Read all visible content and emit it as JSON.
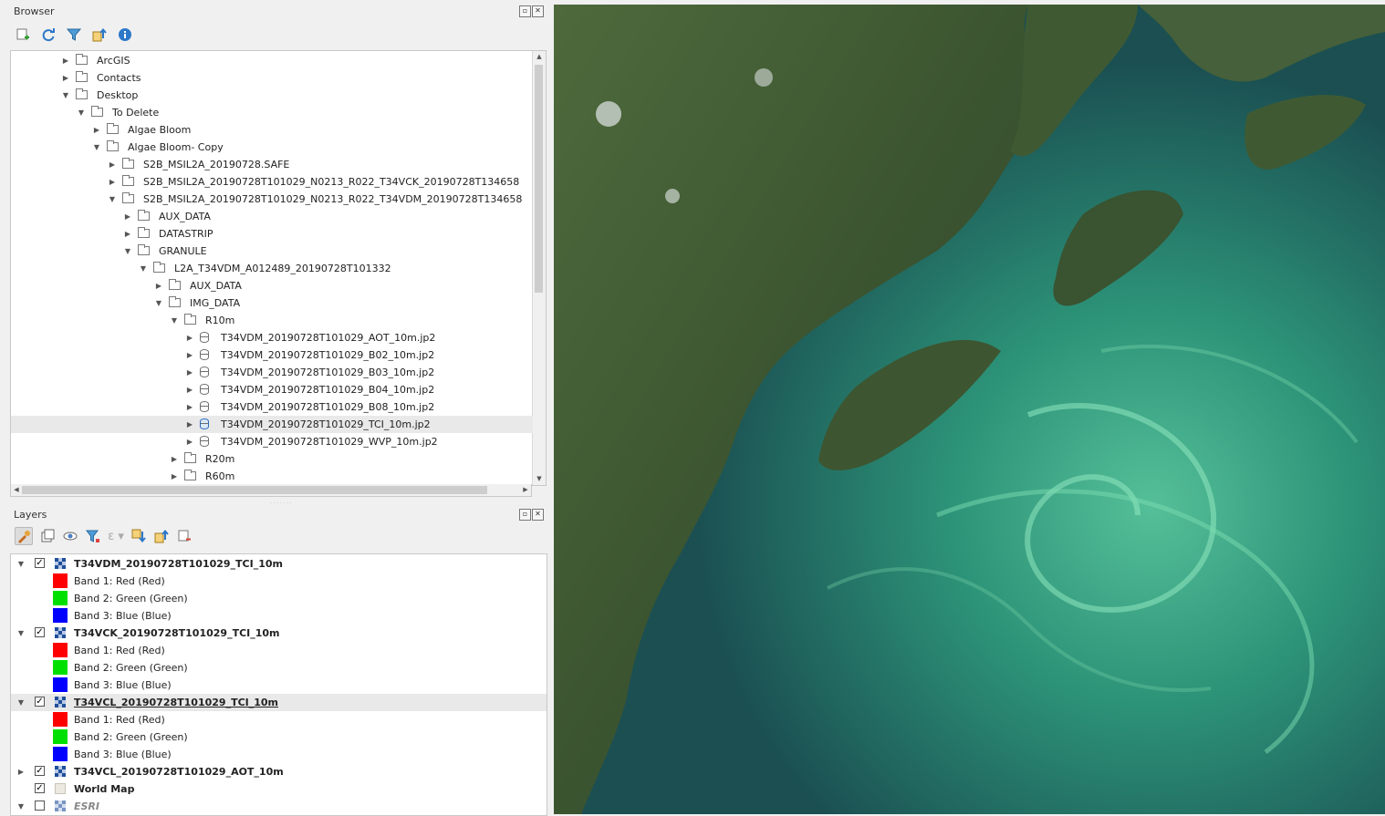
{
  "browser": {
    "title": "Browser",
    "toolbar": [
      "add-selected-icon",
      "refresh-icon",
      "filter-icon",
      "collapse-all-icon",
      "properties-icon"
    ],
    "tree": [
      {
        "indent": 0,
        "type": "folder",
        "arrow": "right",
        "label": "ArcGIS"
      },
      {
        "indent": 0,
        "type": "folder",
        "arrow": "right",
        "label": "Contacts"
      },
      {
        "indent": 0,
        "type": "folder",
        "arrow": "down",
        "label": "Desktop"
      },
      {
        "indent": 1,
        "type": "folder",
        "arrow": "down",
        "label": "To Delete"
      },
      {
        "indent": 2,
        "type": "folder",
        "arrow": "right",
        "label": "Algae Bloom"
      },
      {
        "indent": 2,
        "type": "folder",
        "arrow": "down",
        "label": "Algae Bloom- Copy"
      },
      {
        "indent": 3,
        "type": "folder",
        "arrow": "right",
        "label": "S2B_MSIL2A_20190728.SAFE"
      },
      {
        "indent": 3,
        "type": "folder",
        "arrow": "right",
        "label": "S2B_MSIL2A_20190728T101029_N0213_R022_T34VCK_20190728T134658"
      },
      {
        "indent": 3,
        "type": "folder",
        "arrow": "down",
        "label": "S2B_MSIL2A_20190728T101029_N0213_R022_T34VDM_20190728T134658"
      },
      {
        "indent": 4,
        "type": "folder",
        "arrow": "right",
        "label": "AUX_DATA"
      },
      {
        "indent": 4,
        "type": "folder",
        "arrow": "right",
        "label": "DATASTRIP"
      },
      {
        "indent": 4,
        "type": "folder",
        "arrow": "down",
        "label": "GRANULE"
      },
      {
        "indent": 5,
        "type": "folder",
        "arrow": "down",
        "label": "L2A_T34VDM_A012489_20190728T101332"
      },
      {
        "indent": 6,
        "type": "folder",
        "arrow": "right",
        "label": "AUX_DATA"
      },
      {
        "indent": 6,
        "type": "folder",
        "arrow": "down",
        "label": "IMG_DATA"
      },
      {
        "indent": 7,
        "type": "folder",
        "arrow": "down",
        "label": "R10m"
      },
      {
        "indent": 8,
        "type": "db",
        "arrow": "right",
        "label": "T34VDM_20190728T101029_AOT_10m.jp2"
      },
      {
        "indent": 8,
        "type": "db",
        "arrow": "right",
        "label": "T34VDM_20190728T101029_B02_10m.jp2"
      },
      {
        "indent": 8,
        "type": "db",
        "arrow": "right",
        "label": "T34VDM_20190728T101029_B03_10m.jp2"
      },
      {
        "indent": 8,
        "type": "db",
        "arrow": "right",
        "label": "T34VDM_20190728T101029_B04_10m.jp2"
      },
      {
        "indent": 8,
        "type": "db",
        "arrow": "right",
        "label": "T34VDM_20190728T101029_B08_10m.jp2"
      },
      {
        "indent": 8,
        "type": "db",
        "arrow": "right",
        "label": "T34VDM_20190728T101029_TCI_10m.jp2",
        "selected": true
      },
      {
        "indent": 8,
        "type": "db",
        "arrow": "right",
        "label": "T34VDM_20190728T101029_WVP_10m.jp2"
      },
      {
        "indent": 7,
        "type": "folder",
        "arrow": "right",
        "label": "R20m"
      },
      {
        "indent": 7,
        "type": "folder",
        "arrow": "right",
        "label": "R60m"
      }
    ]
  },
  "layers": {
    "title": "Layers",
    "toolbar": [
      "style-manager-icon",
      "add-group-icon",
      "visibility-icon",
      "filter-legend-icon",
      "expression-filter-icon",
      "expand-all-icon",
      "collapse-all-icon",
      "remove-layer-icon"
    ],
    "tree": [
      {
        "kind": "layer",
        "arrow": "down",
        "checked": true,
        "icon": "raster",
        "label": "T34VDM_20190728T101029_TCI_10m"
      },
      {
        "kind": "band",
        "color": "#ff0000",
        "label": "Band 1: Red (Red)"
      },
      {
        "kind": "band",
        "color": "#00e000",
        "label": "Band 2: Green (Green)"
      },
      {
        "kind": "band",
        "color": "#0000ff",
        "label": "Band 3: Blue (Blue)"
      },
      {
        "kind": "layer",
        "arrow": "down",
        "checked": true,
        "icon": "raster",
        "label": "T34VCK_20190728T101029_TCI_10m"
      },
      {
        "kind": "band",
        "color": "#ff0000",
        "label": "Band 1: Red (Red)"
      },
      {
        "kind": "band",
        "color": "#00e000",
        "label": "Band 2: Green (Green)"
      },
      {
        "kind": "band",
        "color": "#0000ff",
        "label": "Band 3: Blue (Blue)"
      },
      {
        "kind": "layer",
        "arrow": "down",
        "checked": true,
        "icon": "raster",
        "label": "T34VCL_20190728T101029_TCI_10m",
        "selected": true,
        "underline": true
      },
      {
        "kind": "band",
        "color": "#ff0000",
        "label": "Band 1: Red (Red)"
      },
      {
        "kind": "band",
        "color": "#00e000",
        "label": "Band 2: Green (Green)"
      },
      {
        "kind": "band",
        "color": "#0000ff",
        "label": "Band 3: Blue (Blue)"
      },
      {
        "kind": "layer",
        "arrow": "right",
        "checked": true,
        "icon": "raster",
        "label": "T34VCL_20190728T101029_AOT_10m"
      },
      {
        "kind": "layer",
        "arrow": "none",
        "checked": true,
        "icon": "plain",
        "label": "World Map"
      },
      {
        "kind": "layer",
        "arrow": "down",
        "checked": false,
        "icon": "raster-muted",
        "label": "ESRI",
        "italic": true
      }
    ]
  },
  "colors": {
    "water_dark": "#1b4f52",
    "water_bloom": "#3fb888",
    "land": "#3f5a33"
  }
}
